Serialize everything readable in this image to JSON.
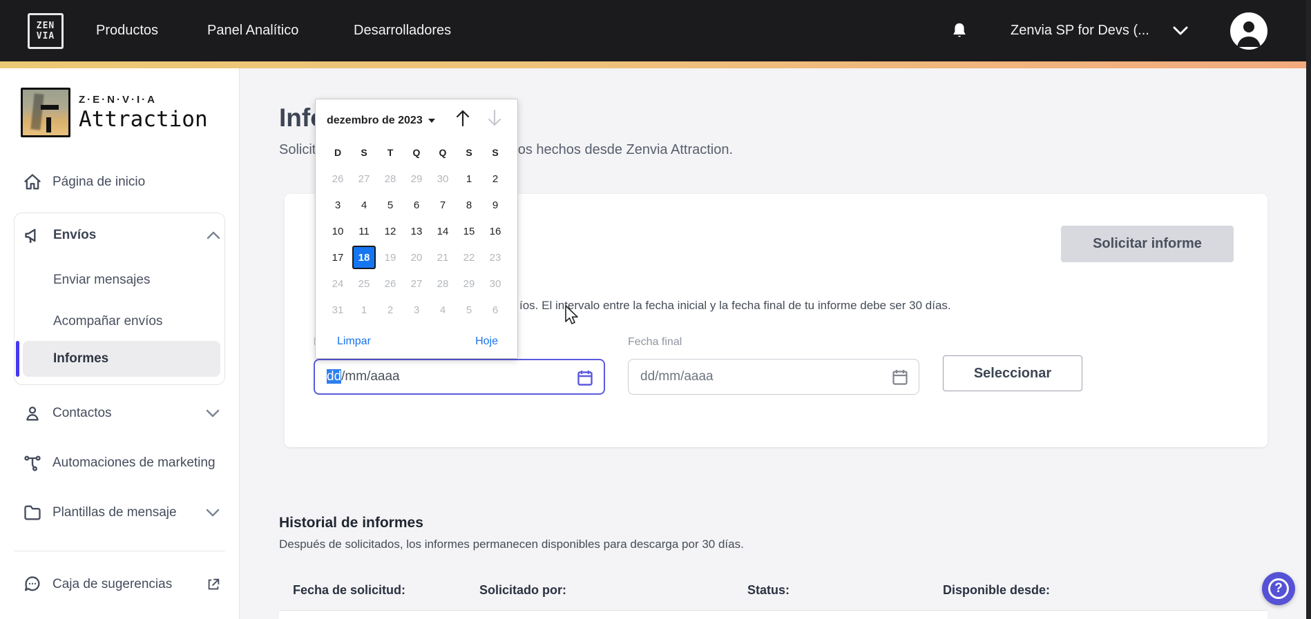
{
  "navbar": {
    "logo_line1": "ZEN",
    "logo_line2": "VIA",
    "items": [
      {
        "label": "Productos"
      },
      {
        "label": "Panel Analítico"
      },
      {
        "label": "Desarrolladores"
      }
    ],
    "account_label": "Zenvia SP for Devs (..."
  },
  "sidebar": {
    "logo": {
      "brand": "Z·E·N·V·I·A",
      "product": "Attraction"
    },
    "items": [
      {
        "label": "Página de inicio"
      },
      {
        "label": "Envíos",
        "expanded": true,
        "children": [
          {
            "label": "Enviar mensajes"
          },
          {
            "label": "Acompañar envíos"
          },
          {
            "label": "Informes",
            "selected": true
          }
        ]
      },
      {
        "label": "Contactos"
      },
      {
        "label": "Automaciones de marketing"
      },
      {
        "label": "Plantillas de mensaje"
      },
      {
        "label": "Caja de sugerencias",
        "external": true
      }
    ]
  },
  "page": {
    "title": "Informes de envío",
    "subtitle": "Solicita informes detallados de los envíos hechos desde Zenvia Attraction."
  },
  "report_card": {
    "request_button": "Solicitar informe",
    "description_fragment": "íos. El intervalo entre la fecha inicial y la fecha final de tu informe debe ser 30 días.",
    "start_date": {
      "label": "Fecha inicial",
      "selected_segment": "dd",
      "rest_segment": "/mm/aaaa"
    },
    "end_date": {
      "label": "Fecha final",
      "placeholder": "dd/mm/aaaa"
    },
    "select_button": "Seleccionar"
  },
  "datepicker": {
    "month_label": "dezembro de 2023",
    "weekdays": [
      "D",
      "S",
      "T",
      "Q",
      "Q",
      "S",
      "S"
    ],
    "weeks": [
      [
        {
          "d": "26",
          "s": "muted"
        },
        {
          "d": "27",
          "s": "muted"
        },
        {
          "d": "28",
          "s": "muted"
        },
        {
          "d": "29",
          "s": "muted"
        },
        {
          "d": "30",
          "s": "muted"
        },
        {
          "d": "1",
          "s": "normal"
        },
        {
          "d": "2",
          "s": "normal"
        }
      ],
      [
        {
          "d": "3",
          "s": "normal"
        },
        {
          "d": "4",
          "s": "normal"
        },
        {
          "d": "5",
          "s": "normal"
        },
        {
          "d": "6",
          "s": "normal"
        },
        {
          "d": "7",
          "s": "normal"
        },
        {
          "d": "8",
          "s": "normal"
        },
        {
          "d": "9",
          "s": "normal"
        }
      ],
      [
        {
          "d": "10",
          "s": "normal"
        },
        {
          "d": "11",
          "s": "normal"
        },
        {
          "d": "12",
          "s": "normal"
        },
        {
          "d": "13",
          "s": "normal"
        },
        {
          "d": "14",
          "s": "normal"
        },
        {
          "d": "15",
          "s": "normal"
        },
        {
          "d": "16",
          "s": "normal"
        }
      ],
      [
        {
          "d": "17",
          "s": "normal"
        },
        {
          "d": "18",
          "s": "selected"
        },
        {
          "d": "19",
          "s": "muted"
        },
        {
          "d": "20",
          "s": "muted"
        },
        {
          "d": "21",
          "s": "muted"
        },
        {
          "d": "22",
          "s": "muted"
        },
        {
          "d": "23",
          "s": "muted"
        }
      ],
      [
        {
          "d": "24",
          "s": "muted"
        },
        {
          "d": "25",
          "s": "muted"
        },
        {
          "d": "26",
          "s": "muted"
        },
        {
          "d": "27",
          "s": "muted"
        },
        {
          "d": "28",
          "s": "muted"
        },
        {
          "d": "29",
          "s": "muted"
        },
        {
          "d": "30",
          "s": "muted"
        }
      ],
      [
        {
          "d": "31",
          "s": "muted"
        },
        {
          "d": "1",
          "s": "muted"
        },
        {
          "d": "2",
          "s": "muted"
        },
        {
          "d": "3",
          "s": "muted"
        },
        {
          "d": "4",
          "s": "muted"
        },
        {
          "d": "5",
          "s": "muted"
        },
        {
          "d": "6",
          "s": "muted"
        }
      ]
    ],
    "selected_day": "18",
    "clear_label": "Limpar",
    "today_label": "Hoje"
  },
  "history": {
    "title": "Historial de informes",
    "subtitle": "Después de solicitados, los informes permanecen disponibles para descarga por 30 días.",
    "columns": [
      "Fecha de solicitud:",
      "Solicitado por:",
      "Status:",
      "Disponible desde:"
    ]
  },
  "help": {
    "glyph": "?"
  },
  "colors": {
    "navbar_bg": "#1b1b1d",
    "gradient_left": "#ecc974",
    "gradient_right": "#f3aa7e",
    "accent_indigo": "#5552d5",
    "sidebar_selected_bar": "#4638f0",
    "selected_day_blue": "#1676f2",
    "link_blue": "#1a73e8",
    "focused_input_border": "#5a5ade"
  }
}
